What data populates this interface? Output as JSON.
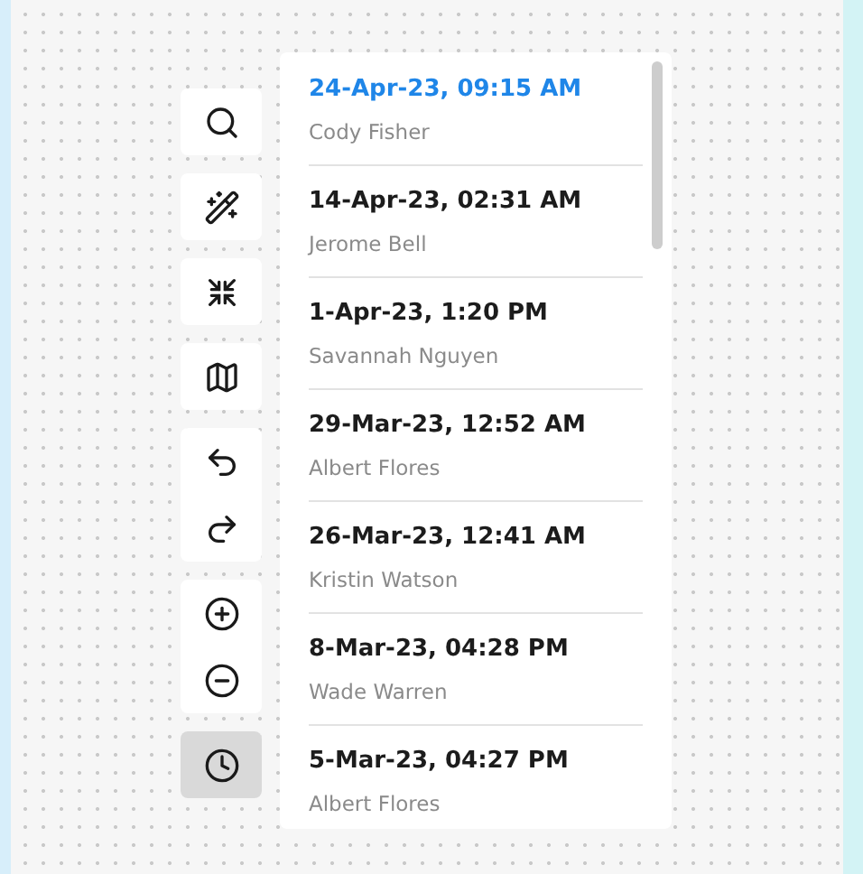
{
  "toolbar": {
    "groups": [
      {
        "tools": [
          {
            "kind": "search",
            "selected": false
          }
        ]
      },
      {
        "tools": [
          {
            "kind": "wand",
            "selected": false
          }
        ]
      },
      {
        "tools": [
          {
            "kind": "collapse",
            "selected": false
          }
        ]
      },
      {
        "tools": [
          {
            "kind": "map",
            "selected": false
          }
        ]
      },
      {
        "tools": [
          {
            "kind": "undo",
            "selected": false
          },
          {
            "kind": "redo",
            "selected": false
          }
        ]
      },
      {
        "tools": [
          {
            "kind": "zoom_in",
            "selected": false
          },
          {
            "kind": "zoom_out",
            "selected": false
          }
        ]
      },
      {
        "tools": [
          {
            "kind": "history",
            "selected": true
          }
        ]
      }
    ]
  },
  "history": {
    "entries": [
      {
        "date": "24-Apr-23, 09:15 AM",
        "author": "Cody Fisher",
        "selected": true
      },
      {
        "date": "14-Apr-23, 02:31 AM",
        "author": "Jerome Bell",
        "selected": false
      },
      {
        "date": "1-Apr-23, 1:20 PM",
        "author": "Savannah Nguyen",
        "selected": false
      },
      {
        "date": "29-Mar-23, 12:52 AM",
        "author": "Albert Flores",
        "selected": false
      },
      {
        "date": "26-Mar-23, 12:41 AM",
        "author": "Kristin Watson",
        "selected": false
      },
      {
        "date": "8-Mar-23, 04:28 PM",
        "author": "Wade Warren",
        "selected": false
      },
      {
        "date": "5-Mar-23, 04:27 PM",
        "author": "Albert Flores",
        "selected": false
      }
    ]
  }
}
